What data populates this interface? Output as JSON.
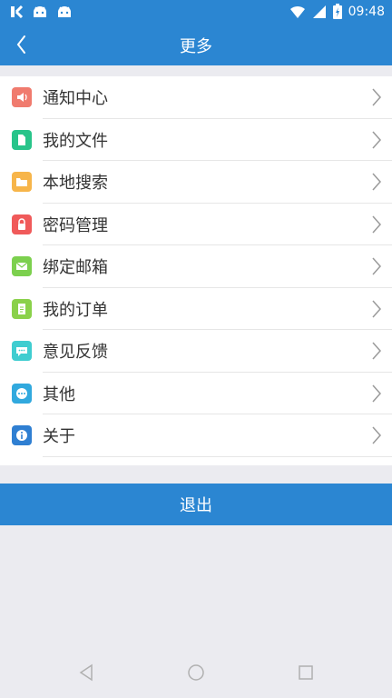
{
  "status": {
    "time": "09:48"
  },
  "header": {
    "title": "更多"
  },
  "menu": [
    {
      "label": "通知中心",
      "icon": "speaker-icon",
      "color": "#f07b6e"
    },
    {
      "label": "我的文件",
      "icon": "file-icon",
      "color": "#28c48a"
    },
    {
      "label": "本地搜索",
      "icon": "folder-icon",
      "color": "#f7b54a"
    },
    {
      "label": "密码管理",
      "icon": "lock-icon",
      "color": "#f05a5a"
    },
    {
      "label": "绑定邮箱",
      "icon": "mail-icon",
      "color": "#7cd04e"
    },
    {
      "label": "我的订单",
      "icon": "order-icon",
      "color": "#8ad14a"
    },
    {
      "label": "意见反馈",
      "icon": "chat-icon",
      "color": "#3fcdd0"
    },
    {
      "label": "其他",
      "icon": "more-dots-icon",
      "color": "#31a9de"
    },
    {
      "label": "关于",
      "icon": "info-icon",
      "color": "#2f7fd2"
    }
  ],
  "logout_label": "退出",
  "colors": {
    "primary": "#2b86d2",
    "background": "#ebebf0"
  }
}
